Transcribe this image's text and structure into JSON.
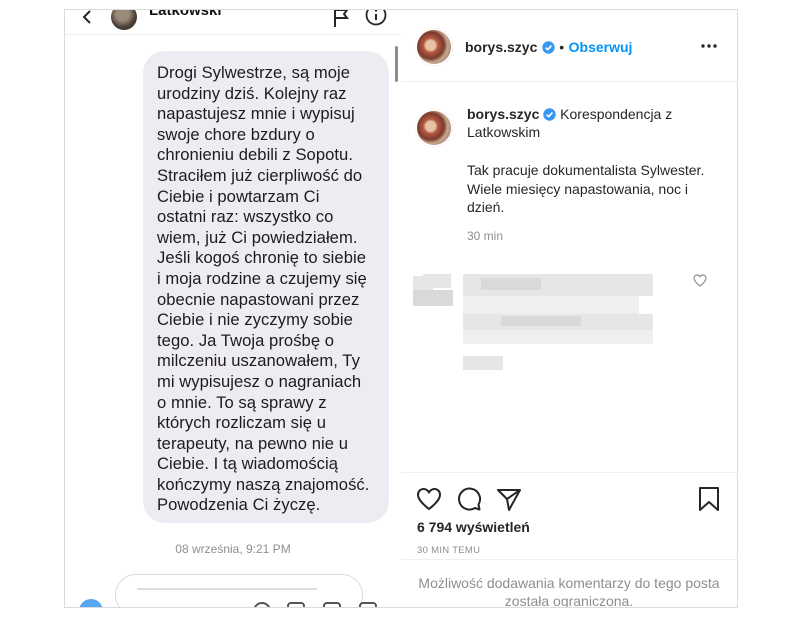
{
  "chat": {
    "contact_name": "Latkowski",
    "message": "Drogi Sylwestrze, są moje\nurodziny dziś. Kolejny raz\nnapastujesz mnie i wypisuj\nswoje chore bzdury o\nchronieniu debili z Sopotu.\nStraciłem już cierpliwość do\nCiebie i powtarzam Ci\nostatni raz: wszystko co\nwiem, już Ci powiedziałem.\nJeśli kogoś chronię to siebie\ni moja rodzine a czujemy się\nobecnie napastowani przez\nCiebie i nie zyczymy sobie\ntego. Ja Twoja prośbę o\nmilczeniu uszanowałem, Ty\nmi wypisujesz o nagraniach\no mnie. To są sprawy z\nktórych rozliczam się u\nterapeuty, na pewno nie u\nCiebie. I tą wiadomością\nkończymy naszą znajomość.\nPowodzenia Ci życzę.",
    "timestamp": "08 września, 9:21 PM"
  },
  "post": {
    "username": "borys.szyc",
    "follow_label": "Obserwuj",
    "caption_title": "Korespondencja z Latkowskim",
    "caption_body": "Tak pracuje dokumentalista Sylwester.\nWiele miesięcy napastowania, noc i\ndzień.",
    "caption_time": "30 min",
    "views": "6 794 wyświetleń",
    "posted_ago": "30 MIN TEMU",
    "comments_disabled": "Możliwość dodawania komentarzy do tego posta została ograniczona."
  },
  "colors": {
    "accent": "#0095f6",
    "bubble": "#efebf3",
    "muted": "#8e8e8e"
  },
  "icons": [
    "back-icon",
    "flag-icon",
    "info-icon",
    "verified-icon",
    "more-icon",
    "heart-icon",
    "comment-icon",
    "share-icon",
    "save-icon"
  ]
}
